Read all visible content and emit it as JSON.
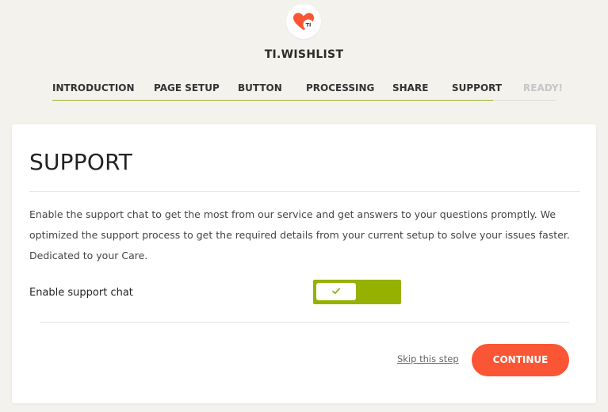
{
  "app": {
    "name": "TI.WISHLIST",
    "logo_icon": "heart-logo-icon",
    "logo_text": "TI",
    "accent_color": "#97b100",
    "brand_color": "#fa5635"
  },
  "steps": [
    {
      "label": "INTRODUCTION",
      "state": "done"
    },
    {
      "label": "PAGE SETUP",
      "state": "done"
    },
    {
      "label": "BUTTON",
      "state": "done"
    },
    {
      "label": "PROCESSING",
      "state": "done"
    },
    {
      "label": "SHARE",
      "state": "done"
    },
    {
      "label": "SUPPORT",
      "state": "current"
    },
    {
      "label": "READY!",
      "state": "upcoming"
    }
  ],
  "card": {
    "title": "SUPPORT",
    "description": "Enable the support chat to get the most from our service and get answers to your questions promptly. We optimized the support process to get the required details from your current setup to solve your issues faster. Dedicated to your Care.",
    "option_label": "Enable support chat",
    "toggle_on": true,
    "toggle_icon": "check-icon",
    "skip_label": "Skip this step",
    "continue_label": "CONTINUE"
  }
}
